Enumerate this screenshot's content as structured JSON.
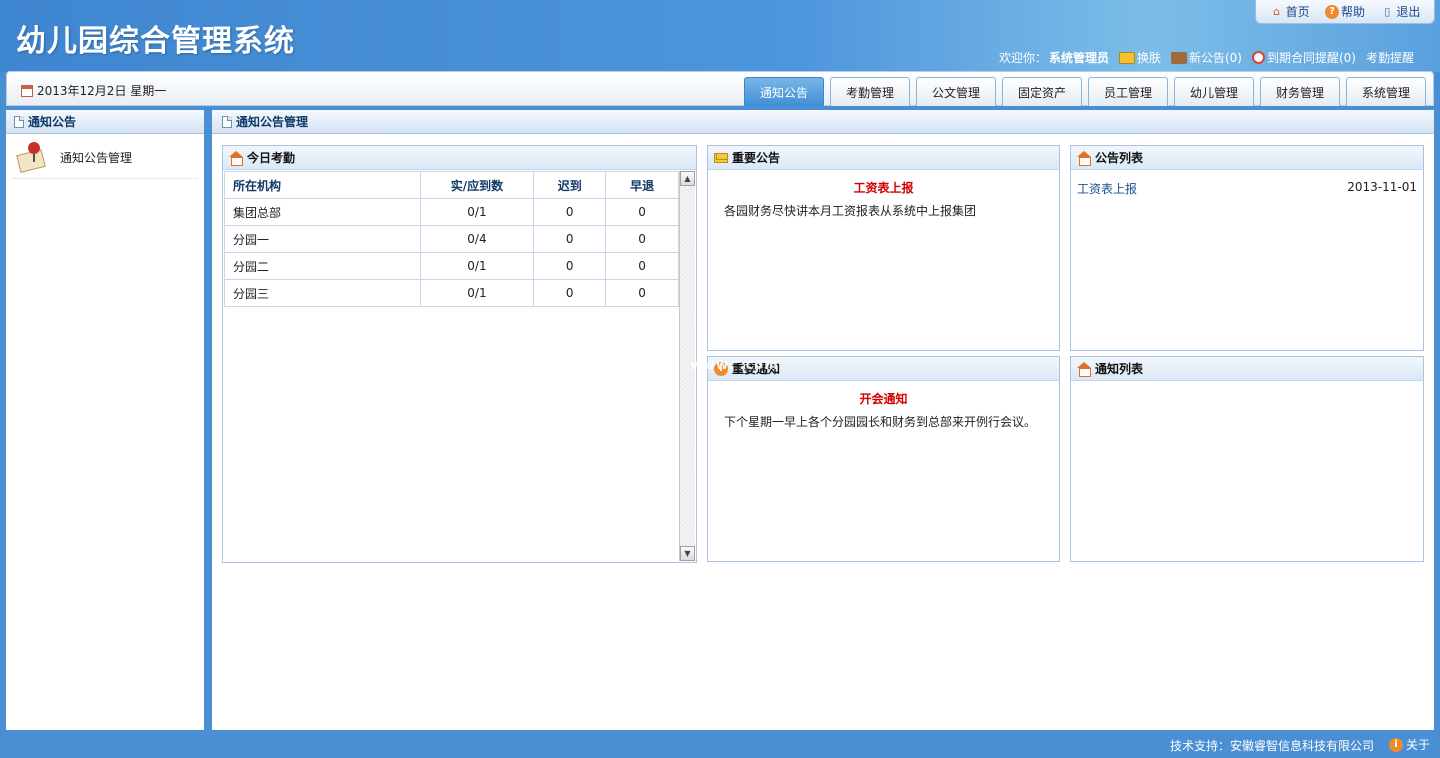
{
  "header": {
    "title": "幼儿园综合管理系统",
    "top_links": {
      "home": "首页",
      "help": "帮助",
      "logout": "退出"
    },
    "user_bar": {
      "welcome": "欢迎你：",
      "username": "系统管理员",
      "skin": "换肤",
      "new_notice": "新公告(0)",
      "contract_reminder": "到期合同提醒(0)",
      "attendance_reminder": "考勤提醒"
    }
  },
  "nav": {
    "date": "2013年12月2日 星期一",
    "tabs": [
      "通知公告",
      "考勤管理",
      "公文管理",
      "固定资产",
      "员工管理",
      "幼儿管理",
      "财务管理",
      "系统管理"
    ],
    "active_tab": "通知公告"
  },
  "sidebar": {
    "title": "通知公告",
    "items": [
      {
        "label": "通知公告管理"
      }
    ]
  },
  "main": {
    "title": "通知公告管理",
    "attendance": {
      "title": "今日考勤",
      "headers": [
        "所在机构",
        "实/应到数",
        "迟到",
        "早退"
      ],
      "rows": [
        [
          "集团总部",
          "0/1",
          "0",
          "0"
        ],
        [
          "分园一",
          "0/4",
          "0",
          "0"
        ],
        [
          "分园二",
          "0/1",
          "0",
          "0"
        ],
        [
          "分园三",
          "0/1",
          "0",
          "0"
        ]
      ]
    },
    "important_notice": {
      "title": "重要公告",
      "item_title": "工资表上报",
      "item_body": "各园财务尽快讲本月工资报表从系统中上报集团"
    },
    "notice_list": {
      "title": "公告列表",
      "items": [
        {
          "label": "工资表上报",
          "date": "2013-11-01"
        }
      ]
    },
    "important_message": {
      "title": "重要通知",
      "item_title": "开会通知",
      "item_body": "下个星期一早上各个分园园长和财务到总部来开例行会议。"
    },
    "message_list": {
      "title": "通知列表"
    },
    "watermark": "www.       .com"
  },
  "footer": {
    "support": "技术支持：安徽睿智信息科技有限公司",
    "about": "关于"
  },
  "colors": {
    "background": "#4a8fd4",
    "active_tab": "#3f8fd6",
    "notice_red": "#d40000",
    "link_blue": "#1c4f94"
  }
}
